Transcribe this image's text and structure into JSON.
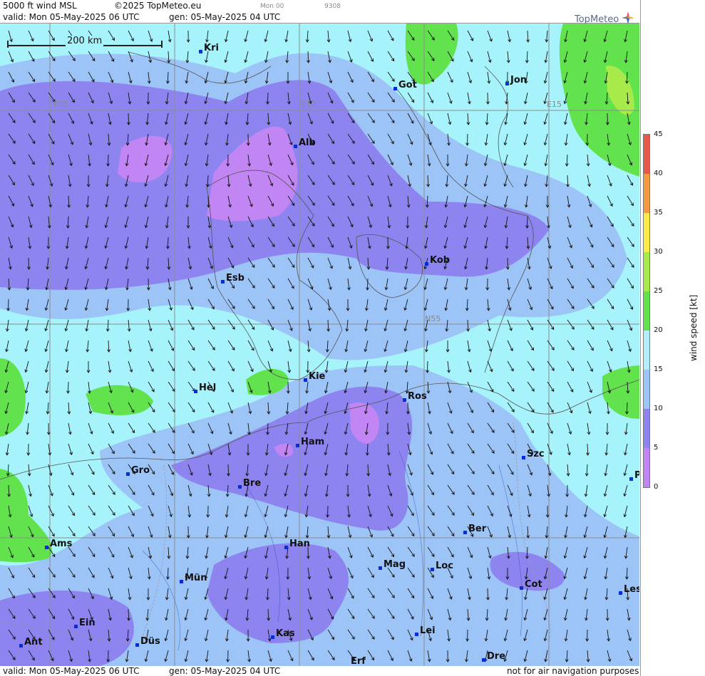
{
  "header": {
    "product": "5000 ft wind MSL",
    "copyright": "©2025 TopMeteo.eu",
    "step": "Mon 00",
    "code": "9308",
    "valid": "valid:  Mon  05-May-2025  06 UTC",
    "generated": "gen: 05-May-2025 04 UTC",
    "logo": "TopMeteo"
  },
  "footer": {
    "valid": "valid:  Mon  05-May-2025  06 UTC",
    "generated": "gen: 05-May-2025 04 UTC",
    "disclaimer": "not for air navigation purposes"
  },
  "scale_bar": {
    "label": "200 km"
  },
  "grid_labels": {
    "e05": "E05",
    "e10": "E10",
    "e15": "E15",
    "n55": "N55"
  },
  "legend": {
    "unit": "wind speed [kt]",
    "ticks": [
      "45",
      "40",
      "35",
      "30",
      "25",
      "20",
      "15",
      "10",
      "5",
      "0"
    ],
    "colors": [
      "#e8584a",
      "#f39a40",
      "#fcec45",
      "#a8ea4a",
      "#62e34e",
      "#b6ecff",
      "#9dc4f7",
      "#8e84ef",
      "#c285f4"
    ]
  },
  "cities": [
    {
      "name": "Kri"
    },
    {
      "name": "Got"
    },
    {
      "name": "Jon"
    },
    {
      "name": "Alb"
    },
    {
      "name": "Kob"
    },
    {
      "name": "Esb"
    },
    {
      "name": "Kie"
    },
    {
      "name": "Hel"
    },
    {
      "name": "Ros"
    },
    {
      "name": "Ham"
    },
    {
      "name": "Szc"
    },
    {
      "name": "Gro"
    },
    {
      "name": "Bre"
    },
    {
      "name": "P"
    },
    {
      "name": "Ber"
    },
    {
      "name": "Ams"
    },
    {
      "name": "Han"
    },
    {
      "name": "Mag"
    },
    {
      "name": "Loc"
    },
    {
      "name": "Mün"
    },
    {
      "name": "Cot"
    },
    {
      "name": "Les"
    },
    {
      "name": "Ein"
    },
    {
      "name": "Lei"
    },
    {
      "name": "Kas"
    },
    {
      "name": "Ant"
    },
    {
      "name": "Düs"
    },
    {
      "name": "Dre"
    },
    {
      "name": "Erf"
    }
  ],
  "colors": {
    "speed_0_5": "#c285f4",
    "speed_5_10": "#8e84ef",
    "speed_10_15": "#9dc4f7",
    "speed_15_20": "#a7f3fb",
    "speed_20_25": "#62e34e",
    "speed_25_30": "#a8ea4a",
    "city_marker": "#0a2bd8"
  }
}
